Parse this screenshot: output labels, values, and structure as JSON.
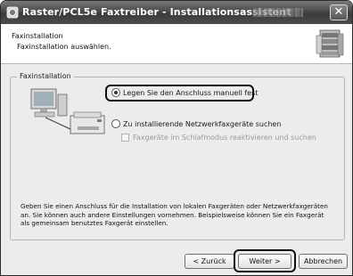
{
  "window": {
    "title": "Raster/PCL5e Faxtreiber - Installationsassistent",
    "close_glyph": "✕"
  },
  "header": {
    "title": "Faxinstallation",
    "subtitle": "Faxinstallation auswählen."
  },
  "group": {
    "legend": "Faxinstallation",
    "options": [
      {
        "label": "Legen Sie den Anschluss manuell fest",
        "checked": true
      },
      {
        "label": "Zu installierende Netzwerkfaxgeräte suchen",
        "checked": false
      }
    ],
    "checkbox": {
      "label": "Faxgeräte im Schlafmodus reaktivieren und suchen",
      "checked": false,
      "enabled": false
    },
    "description": "Geben Sie einen Anschluss für die Installation von lokalen Faxgeräten oder Netzwerkfaxgeräten an. Sie können auch andere Einstellungen vornehmen. Beispielsweise können Sie ein Faxgerät als gemeinsam benutztes Faxgerät einstellen."
  },
  "buttons": {
    "back": "< Zurück",
    "next": "Weiter >",
    "cancel": "Abbrechen"
  },
  "icons": [
    "app-icon",
    "printer-stack-icon",
    "computer-printer-illustration",
    "close-icon"
  ],
  "colors": {
    "titlebar": "#4a4a4a",
    "dialog_bg": "#ececec",
    "highlight_border": "#111111"
  }
}
